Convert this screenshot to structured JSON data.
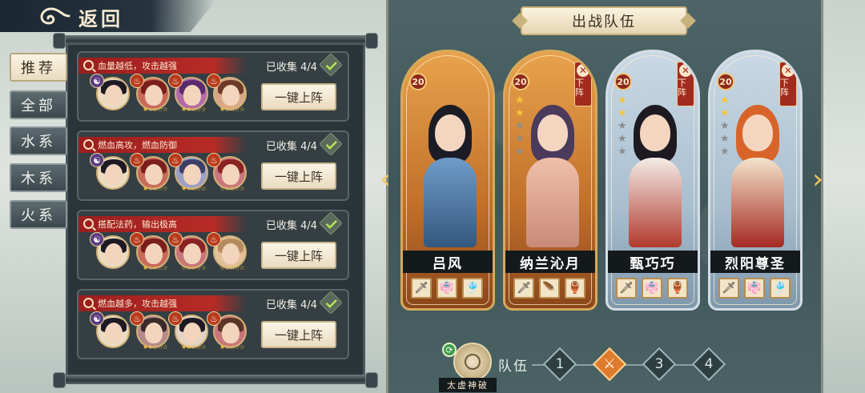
{
  "header": {
    "back_label": "返回"
  },
  "sidebar": {
    "tabs": [
      {
        "label": "推荐",
        "active": true
      },
      {
        "label": "全部",
        "active": false
      },
      {
        "label": "水系",
        "active": false
      },
      {
        "label": "木系",
        "active": false
      },
      {
        "label": "火系",
        "active": false
      }
    ]
  },
  "team_list": [
    {
      "desc": "血量越低，攻击越强",
      "collected": "已收集 4/4",
      "button": "一键上阵"
    },
    {
      "desc": "燃血高攻，燃血防御",
      "collected": "已收集 4/4",
      "button": "一键上阵"
    },
    {
      "desc": "搭配法药，输出极高",
      "collected": "已收集 4/4",
      "button": "一键上阵"
    },
    {
      "desc": "燃血越多，攻击越强",
      "collected": "已收集 4/4",
      "button": "一键上阵"
    }
  ],
  "panel": {
    "title": "出战队伍",
    "characters": [
      {
        "name": "吕风",
        "level": "20",
        "stars": 0,
        "removable": false,
        "frame": "gold"
      },
      {
        "name": "纳兰沁月",
        "level": "20",
        "stars": 2,
        "removable": true,
        "frame": "gold"
      },
      {
        "name": "甄巧巧",
        "level": "20",
        "stars": 2,
        "removable": true,
        "frame": "blue"
      },
      {
        "name": "烈阳尊圣",
        "level": "20",
        "stars": 2,
        "removable": true,
        "frame": "blue"
      }
    ],
    "remove_label": "下阵"
  },
  "bottom": {
    "skill_name": "太虚神破",
    "team_label": "队伍",
    "slots": [
      "1",
      "",
      "3",
      "4"
    ],
    "active_slot": 2
  },
  "colors": {
    "accent_red": "#a22b1f",
    "gold": "#f5c638",
    "panel_teal": "#3f5658"
  }
}
